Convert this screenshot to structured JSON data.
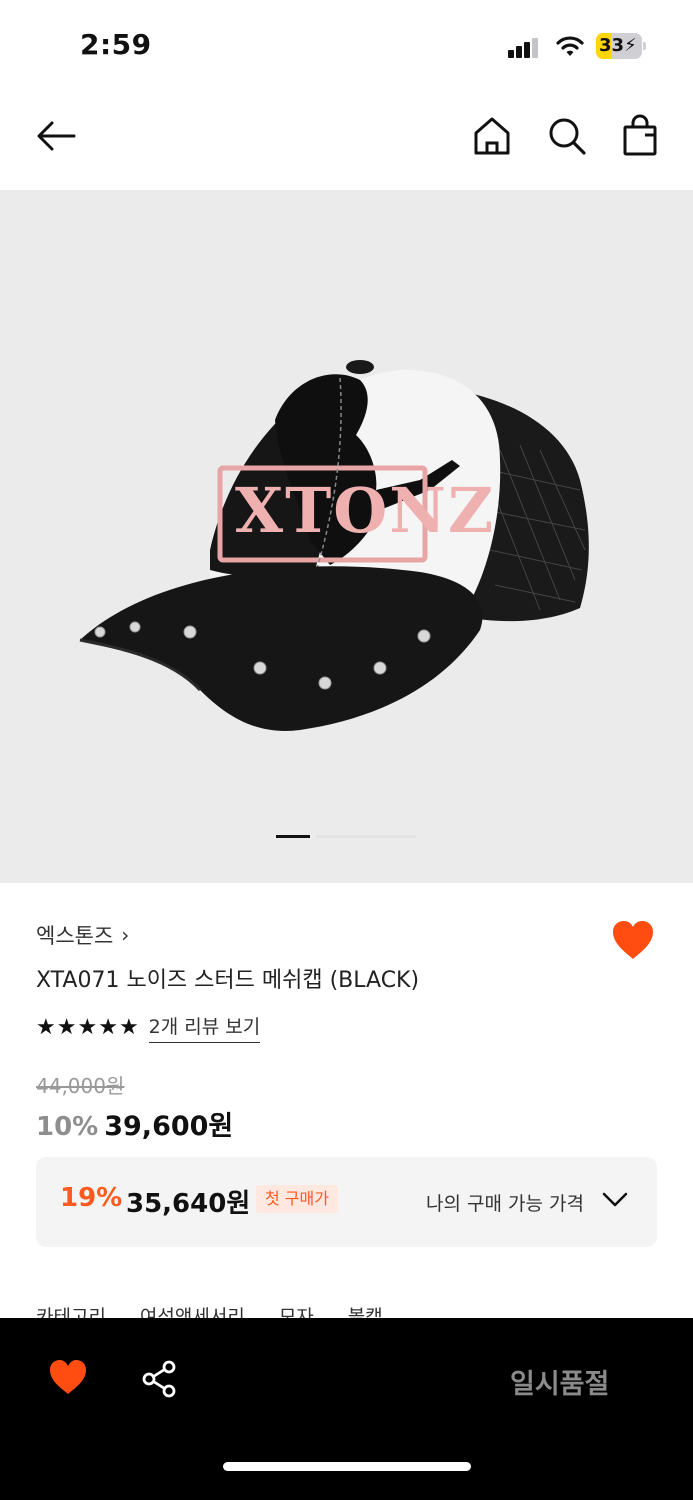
{
  "status_bar": {
    "time": "2:59",
    "battery_level": "33",
    "battery_fraction": 0.33
  },
  "header": {
    "back_icon": "arrow-left-icon",
    "home_icon": "home-icon",
    "search_icon": "search-icon",
    "bag_icon": "shopping-bag-icon"
  },
  "gallery": {
    "image_subject": "black and white trucker mesh cap with studded brim",
    "current_index": 1,
    "total_images": 5
  },
  "product": {
    "brand": "엑스톤즈",
    "brand_chevron": "›",
    "title": "XTA071 노이즈 스터드 메쉬캡 (BLACK)",
    "rating": 5,
    "review_link": "2개 리뷰 보기",
    "original_price": "44,000원",
    "discount_rate": "10%",
    "sale_price": "39,600원",
    "wishlisted": true
  },
  "benefit": {
    "discount_rate": "19%",
    "price": "35,640원",
    "badge": "첫 구매가",
    "label": "나의 구매 가능 가격"
  },
  "categories": [
    "카테고리",
    "여성액세서리",
    "모자",
    "볼캡"
  ],
  "bottom_bar": {
    "soldout_label": "일시품절"
  },
  "colors": {
    "accent": "#ff5a1f",
    "heart": "#ff4d12",
    "bottom_bar_bg": "#000000",
    "gallery_bg": "#ebebeb"
  }
}
